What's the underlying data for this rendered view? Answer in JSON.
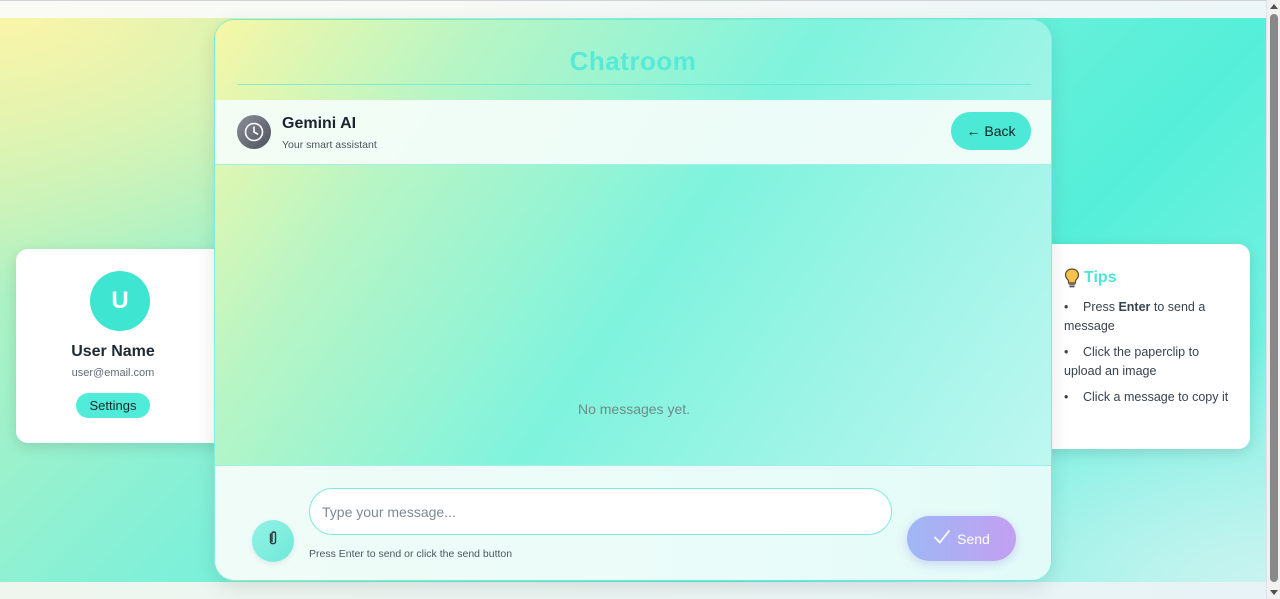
{
  "main": {
    "title": "Chatroom"
  },
  "chat_header": {
    "bot_name": "Gemini AI",
    "bot_subtitle": "Your smart assistant",
    "back_label": "← Back",
    "avatar_icon": "clock-icon"
  },
  "messages": {
    "empty_text": "No messages yet."
  },
  "composer": {
    "input_placeholder": "Type your message...",
    "input_value": "",
    "hint": "Press Enter to send or click the send button",
    "send_label": "Send",
    "send_icon": "checkmark-icon",
    "attach_icon": "paperclip-icon"
  },
  "profile": {
    "initial": "U",
    "name": "User Name",
    "email": "user@email.com",
    "settings_label": "Settings"
  },
  "tips": {
    "title": "Tips",
    "icon": "lightbulb-icon",
    "items": [
      {
        "pre": "Press ",
        "bold": "Enter",
        "post": " to send a message"
      },
      {
        "pre": "Click the paperclip to upload an image",
        "bold": "",
        "post": ""
      },
      {
        "pre": "Click a message to copy it",
        "bold": "",
        "post": ""
      }
    ]
  },
  "colors": {
    "accent": "#4be9d6",
    "send_gradient_start": "#9fb7f5",
    "send_gradient_end": "#c39ff2"
  }
}
